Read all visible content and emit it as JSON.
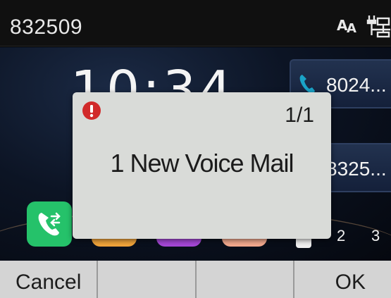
{
  "status_bar": {
    "title": "832509",
    "icons": [
      "font-size-icon",
      "network-icon"
    ]
  },
  "desktop": {
    "clock": "10:34",
    "line_keys": [
      {
        "label": "8024...",
        "icon": "phone-icon"
      },
      {
        "label": "8325..."
      }
    ],
    "apps": [
      "call-transfer-icon",
      "orange-app-icon",
      "purple-app-icon",
      "peach-app-icon"
    ],
    "page_indicators": [
      "2",
      "3"
    ]
  },
  "popup": {
    "icon": "alert-icon",
    "counter": "1/1",
    "message": "1 New Voice Mail"
  },
  "softkeys": {
    "cancel": "Cancel",
    "key2": "",
    "key3": "",
    "ok": "OK"
  },
  "colors": {
    "alert_red": "#d12a2a",
    "call_green": "#25c26a",
    "line_key_phone": "#1aa3c7"
  }
}
